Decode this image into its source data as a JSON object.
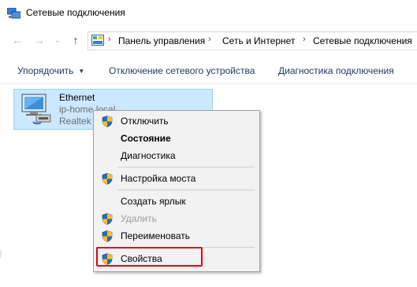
{
  "window": {
    "title": "Сетевые подключения"
  },
  "nav": {
    "back_glyph": "←",
    "forward_glyph": "→",
    "recent_glyph": "⌄",
    "up_glyph": "↑"
  },
  "address": {
    "separator": "›",
    "crumbs": [
      "Панель управления",
      "Сеть и Интернет",
      "Сетевые подключения"
    ]
  },
  "toolbar": {
    "organize_label": "Упорядочить",
    "disable_label": "Отключение сетевого устройства",
    "diagnose_label": "Диагностика подключения"
  },
  "connection": {
    "name": "Ethernet",
    "network": "ip-home.local",
    "adapter": "Realtek"
  },
  "context_menu": {
    "items": [
      {
        "label": "Отключить",
        "icon": "uac-shield-icon"
      },
      {
        "label": "Состояние",
        "bold": true
      },
      {
        "label": "Диагностика"
      },
      {
        "label": "Настройка моста",
        "icon": "uac-shield-icon"
      },
      {
        "label": "Создать ярлык"
      },
      {
        "label": "Удалить",
        "icon": "uac-shield-icon",
        "disabled": true
      },
      {
        "label": "Переименовать",
        "icon": "uac-shield-icon"
      },
      {
        "label": "Свойства",
        "icon": "uac-shield-icon",
        "highlighted": true
      }
    ]
  },
  "colors": {
    "selection_bg": "#cce8ff",
    "selection_border": "#99d1ff",
    "menu_bg": "#f2f2f2",
    "highlight_border": "#e2001a"
  }
}
